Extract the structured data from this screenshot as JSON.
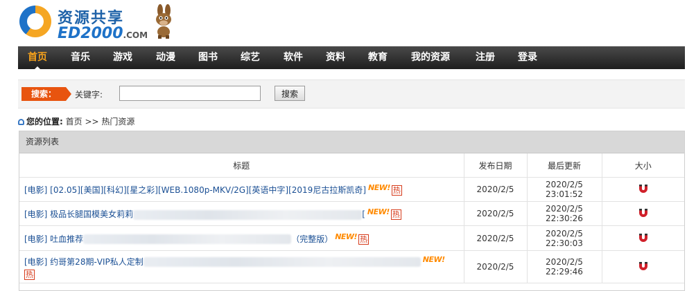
{
  "logo": {
    "cn": "资源共享",
    "en": "ED2000",
    "com": ".COM"
  },
  "nav": {
    "items": [
      {
        "label": "首页",
        "active": true
      },
      {
        "label": "音乐"
      },
      {
        "label": "游戏"
      },
      {
        "label": "动漫"
      },
      {
        "label": "图书"
      },
      {
        "label": "综艺"
      },
      {
        "label": "软件"
      },
      {
        "label": "资料"
      },
      {
        "label": "教育"
      },
      {
        "label": "我的资源"
      },
      {
        "label": "注册"
      },
      {
        "label": "登录"
      }
    ]
  },
  "search": {
    "tag": "搜索：",
    "label": "关键字:",
    "input_value": "",
    "button": "搜索"
  },
  "breadcrumb": {
    "prefix": "您的位置:",
    "home": "首页",
    "separator": ">>",
    "current": "热门资源"
  },
  "panel": {
    "title": "资源列表"
  },
  "table": {
    "headers": [
      "标题",
      "发布日期",
      "最后更新",
      "大小"
    ],
    "rows": [
      {
        "title": "[电影] [02.05][美国][科幻][星之彩][WEB.1080p-MKV/2G][英语中字][2019尼古拉斯凯奇]",
        "date": "2020/2/5",
        "updated": "2020/2/5 23:01:52"
      },
      {
        "title": "[电影] 极品长腿国模美女莉莉",
        "title_tail": "[",
        "date": "2020/2/5",
        "updated": "2020/2/5 22:30:26"
      },
      {
        "title": "[电影] 吐血推荐",
        "title_tail": "（完整版）",
        "date": "2020/2/5",
        "updated": "2020/2/5 22:30:03"
      },
      {
        "title": "[电影] 约哥第28期-VIP私人定制",
        "date": "2020/2/5",
        "updated": "2020/2/5 22:29:46"
      }
    ],
    "new_badge": "NEW!",
    "hot_badge": "热"
  },
  "colors": {
    "nav_bg": "#2e2e2e",
    "active": "#f7a21b",
    "search_tag": "#e8540f",
    "link": "#1a4f94",
    "hot": "#d63a1a"
  }
}
